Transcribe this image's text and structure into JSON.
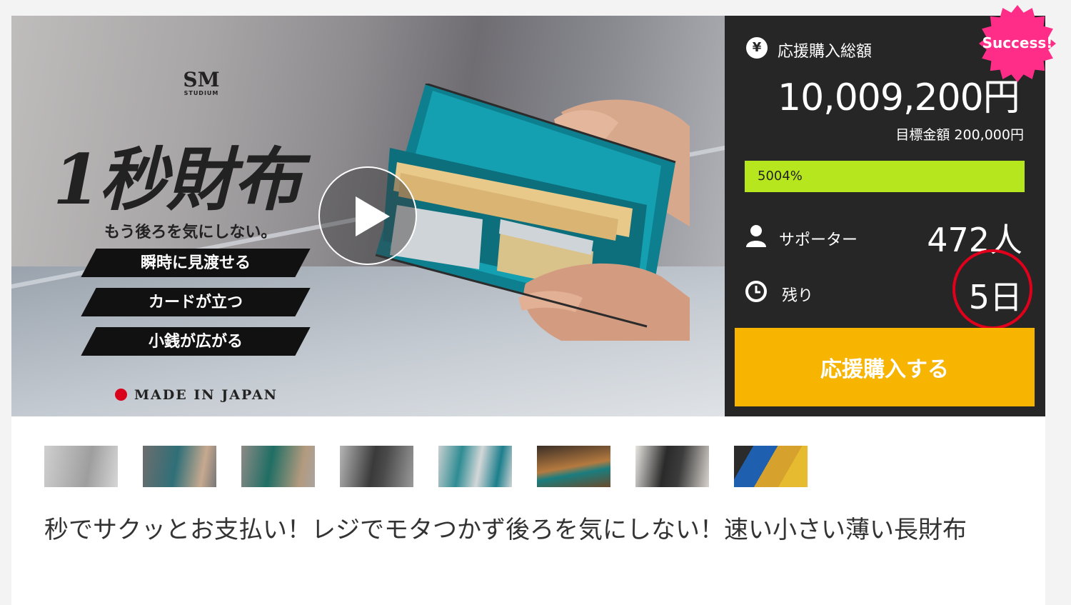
{
  "hero": {
    "logo_mark": "SM",
    "logo_text": "STUDIUM",
    "title": "1秒財布",
    "subtitle": "もう後ろを気にしない。",
    "features": [
      "瞬時に見渡せる",
      "カードが立つ",
      "小銭が広がる"
    ],
    "made_in": "MADE IN JAPAN"
  },
  "panel": {
    "total_label": "応援購入総額",
    "total_value": "10,009,200円",
    "goal": "目標金額 200,000円",
    "progress_text": "5004%",
    "progress_fraction": 1.0,
    "supporters_label": "サポーター",
    "supporters_value": "472人",
    "remaining_label": "残り",
    "remaining_value": "5日",
    "buy_label": "応援購入する",
    "badge": "Success!",
    "yen_icon": "¥"
  },
  "colors": {
    "panel_bg": "#262626",
    "progress": "#b6e61d",
    "buy_button": "#f7b400",
    "badge": "#ff2d87",
    "circle": "#e0001b"
  },
  "thumbnails": [
    {
      "name": "thumb-1"
    },
    {
      "name": "thumb-2"
    },
    {
      "name": "thumb-3"
    },
    {
      "name": "thumb-4"
    },
    {
      "name": "thumb-5"
    },
    {
      "name": "thumb-6"
    },
    {
      "name": "thumb-7"
    },
    {
      "name": "thumb-8"
    }
  ],
  "description": "秒でサクッとお支払い！レジでモタつかず後ろを気にしない！速い小さい薄い長財布"
}
